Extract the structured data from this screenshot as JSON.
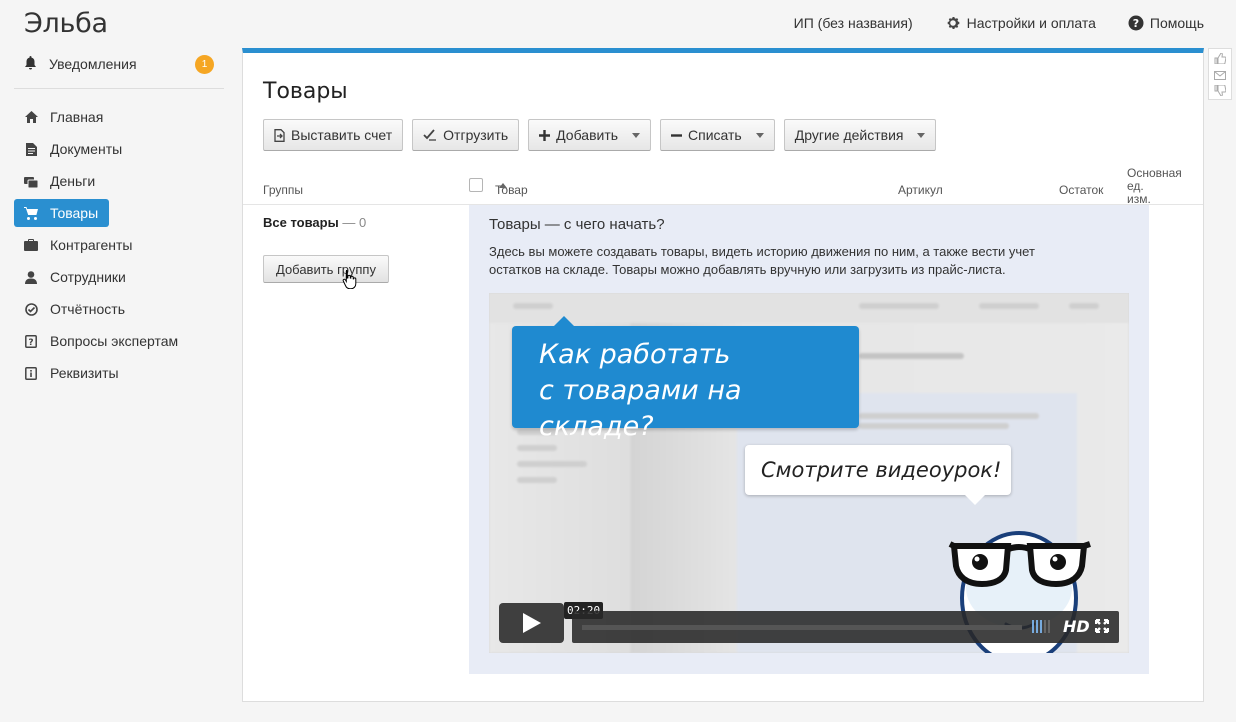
{
  "app": {
    "logo": "Эльба"
  },
  "topbar": {
    "company": "ИП (без названия)",
    "settings": "Настройки и оплата",
    "help": "Помощь"
  },
  "sidebar": {
    "notifications": {
      "label": "Уведомления",
      "count": "1"
    },
    "items": [
      {
        "label": "Главная",
        "icon": "home-icon"
      },
      {
        "label": "Документы",
        "icon": "document-icon"
      },
      {
        "label": "Деньги",
        "icon": "money-icon"
      },
      {
        "label": "Товары",
        "icon": "cart-icon",
        "active": true
      },
      {
        "label": "Контрагенты",
        "icon": "briefcase-icon"
      },
      {
        "label": "Сотрудники",
        "icon": "person-icon"
      },
      {
        "label": "Отчётность",
        "icon": "report-icon"
      },
      {
        "label": "Вопросы экспертам",
        "icon": "question-icon"
      },
      {
        "label": "Реквизиты",
        "icon": "info-icon"
      }
    ]
  },
  "main": {
    "title": "Товары",
    "toolbar": {
      "invoice": "Выставить счет",
      "ship": "Отгрузить",
      "add": "Добавить",
      "writeoff": "Списать",
      "other": "Другие действия"
    },
    "columns": {
      "groups": "Группы",
      "product": "Товар",
      "article": "Артикул",
      "stock": "Остаток",
      "unit_line1": "Основная",
      "unit_line2": "ед. изм."
    },
    "groups": {
      "all_label": "Все товары",
      "all_sep": "—",
      "all_count": "0",
      "add_group": "Добавить группу"
    },
    "help": {
      "title": "Товары — с чего начать?",
      "text": "Здесь вы можете создавать товары, видеть историю движения по ним, а также вести учет остатков на складе. Товары можно добавлять вручную или загрузить из прайс-листа."
    },
    "video": {
      "bubble_line1": "Как работать",
      "bubble_line2": "с товарами на складе?",
      "bubble2": "Смотрите видеоурок!",
      "time": "02:20",
      "hd": "HD"
    }
  },
  "colors": {
    "accent": "#2a8fd0",
    "badge": "#f5a623",
    "help_bg": "#e8ecf6"
  }
}
